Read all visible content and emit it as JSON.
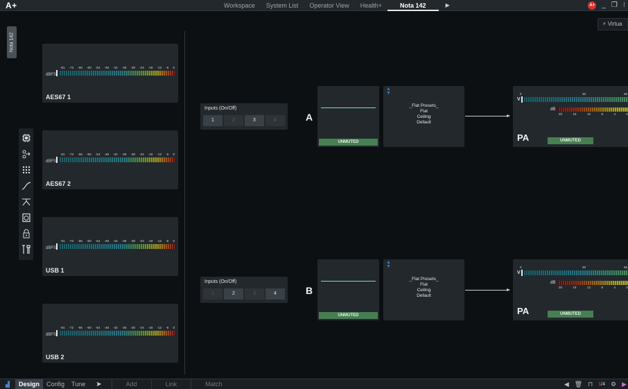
{
  "app": {
    "logo": "A+"
  },
  "topnav": {
    "tabs": [
      {
        "label": "Workspace",
        "active": false
      },
      {
        "label": "System List",
        "active": false
      },
      {
        "label": "Operator View",
        "active": false
      },
      {
        "label": "Health+",
        "active": false
      },
      {
        "label": "Nota 142",
        "active": true
      }
    ],
    "alert_badge": "A+",
    "virtual_label": "Virtua"
  },
  "side": {
    "device_tab": "Nota 142",
    "tools": [
      "processor-icon",
      "routing-icon",
      "grid-icon",
      "curve-icon",
      "delay-icon",
      "speaker-icon",
      "lock-icon",
      "tools-icon"
    ]
  },
  "meter_scale": [
    "-81",
    "-72",
    "-66",
    "-60",
    "-54",
    "-48",
    "-42",
    "-36",
    "-30",
    "-24",
    "-18",
    "-12",
    "-6",
    "0"
  ],
  "meter_unit": "dBFS",
  "sources": [
    {
      "name": "AES67 1"
    },
    {
      "name": "AES67 2"
    },
    {
      "name": "USB 1"
    },
    {
      "name": "USB 2"
    }
  ],
  "channels": [
    {
      "letter": "A",
      "inputs_title": "Inputs (On/Off)",
      "inputs": [
        {
          "label": "1",
          "on": true
        },
        {
          "label": "2",
          "on": false
        },
        {
          "label": "3",
          "on": true
        },
        {
          "label": "4",
          "on": false
        }
      ],
      "mute_status": "UNMUTED",
      "presets": [
        "_Flat Presets_",
        "Flat",
        "Ceiling",
        "Default"
      ],
      "output": {
        "name": "PA",
        "v_label": "V",
        "v_scale": [
          "0",
          "30",
          "58"
        ],
        "db_label": "dB",
        "db_scale": [
          "20",
          "16",
          "12",
          "8",
          "4",
          "0"
        ],
        "status": "UNMUTED"
      }
    },
    {
      "letter": "B",
      "inputs_title": "Inputs (On/Off)",
      "inputs": [
        {
          "label": "1",
          "on": false
        },
        {
          "label": "2",
          "on": true
        },
        {
          "label": "3",
          "on": false
        },
        {
          "label": "4",
          "on": true
        }
      ],
      "mute_status": "UNMUTED",
      "presets": [
        "_Flat Presets_",
        "Flat",
        "Ceiling",
        "Default"
      ],
      "output": {
        "name": "PA",
        "v_label": "V",
        "v_scale": [
          "0",
          "30",
          "58"
        ],
        "db_label": "dB",
        "db_scale": [
          "20",
          "16",
          "12",
          "8",
          "4",
          "0"
        ],
        "status": "UNMUTED"
      }
    }
  ],
  "bottombar": {
    "modes": [
      {
        "label": "Design",
        "active": true
      },
      {
        "label": "Config",
        "active": false
      },
      {
        "label": "Tune",
        "active": false
      }
    ],
    "tools": [
      "Add",
      "Link",
      "Match"
    ],
    "count_current": "1",
    "count_total": "/4"
  }
}
